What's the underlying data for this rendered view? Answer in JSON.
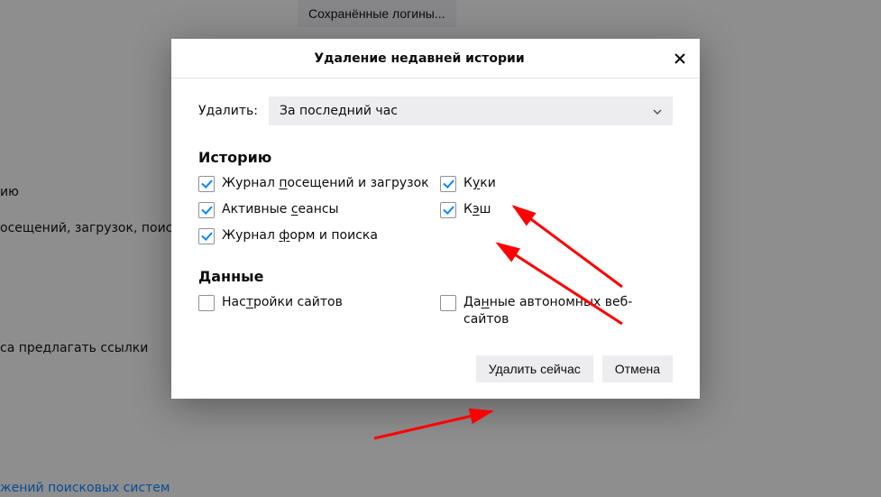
{
  "background": {
    "saved_logins_button": "Сохранённые логины...",
    "text_iyu": "ию",
    "text_visits": "осещений, загрузок, поиск",
    "text_suggest_links": "са предлагать ссылки",
    "link_search_engines": "жений поисковых систем"
  },
  "dialog": {
    "title": "Удаление недавней истории",
    "delete_label": "Удалить:",
    "range_value": "За последний час",
    "section_history": "Историю",
    "section_data": "Данные",
    "checkboxes": {
      "browsing": {
        "label_pre": "Журнал ",
        "label_u": "п",
        "label_post": "осещений и загрузок",
        "checked": true
      },
      "cookies": {
        "label_pre": "К",
        "label_u": "у",
        "label_post": "ки",
        "checked": true
      },
      "sessions": {
        "label_pre": "Активные ",
        "label_u": "с",
        "label_post": "еансы",
        "checked": true
      },
      "cache": {
        "label_pre": "К",
        "label_u": "э",
        "label_post": "ш",
        "checked": true
      },
      "forms": {
        "label_pre": "Журнал ",
        "label_u": "ф",
        "label_post": "орм и поиска",
        "checked": true
      },
      "siteprefs": {
        "label_pre": "Нас",
        "label_u": "т",
        "label_post": "ройки сайтов",
        "checked": false
      },
      "offline": {
        "label_pre": "Да",
        "label_u": "н",
        "label_post": "ные автономных веб-сайтов",
        "checked": false
      }
    },
    "buttons": {
      "clear_now": "Удалить сейчас",
      "cancel": "Отмена"
    }
  }
}
